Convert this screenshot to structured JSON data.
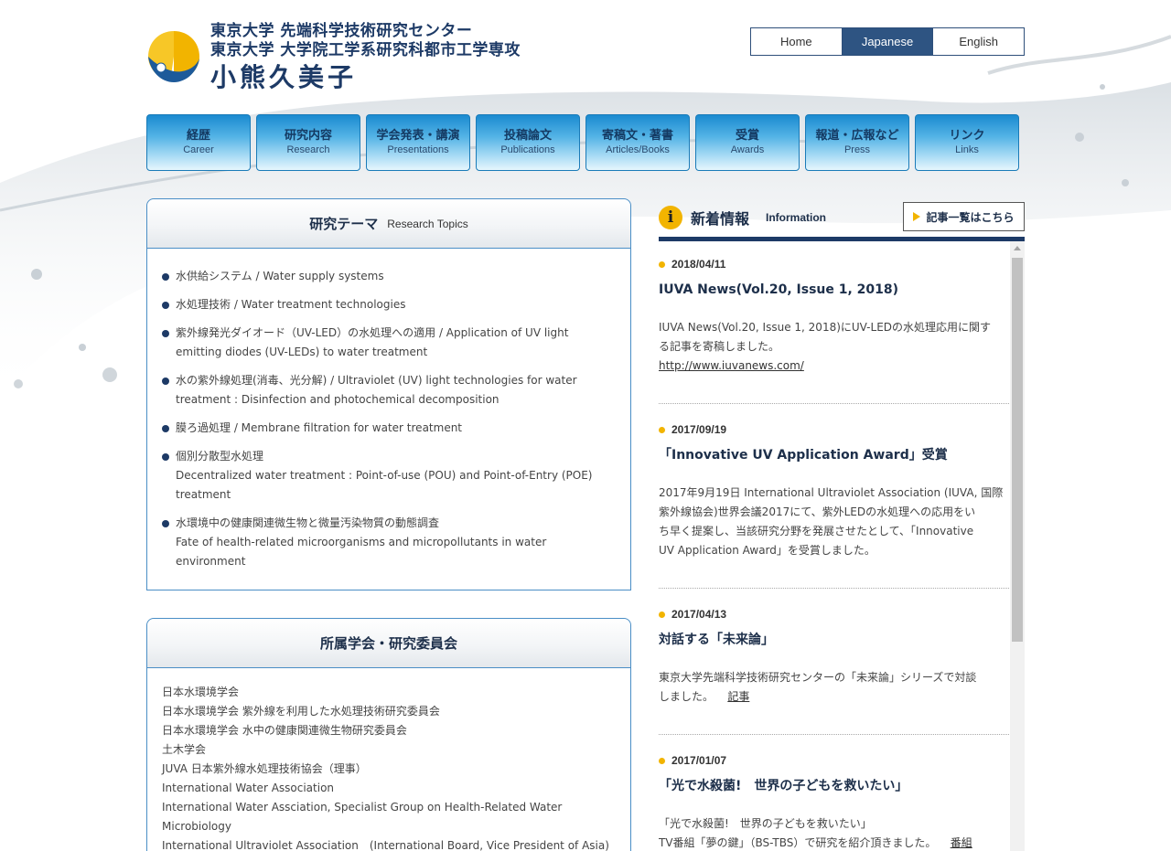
{
  "header": {
    "org_line1": "東京大学 先端科学技術研究センター",
    "org_line2": "東京大学 大学院工学系研究科都市工学専攻",
    "person_name": "小熊久美子"
  },
  "language_switch": {
    "items": [
      {
        "label": "Home",
        "active": false
      },
      {
        "label": "Japanese",
        "active": true
      },
      {
        "label": "English",
        "active": false
      }
    ]
  },
  "nav": {
    "items": [
      {
        "jp": "経歴",
        "en": "Career"
      },
      {
        "jp": "研究内容",
        "en": "Research"
      },
      {
        "jp": "学会発表・講演",
        "en": "Presentations"
      },
      {
        "jp": "投稿論文",
        "en": "Publications"
      },
      {
        "jp": "寄稿文・著書",
        "en": "Articles/Books"
      },
      {
        "jp": "受賞",
        "en": "Awards"
      },
      {
        "jp": "報道・広報など",
        "en": "Press"
      },
      {
        "jp": "リンク",
        "en": "Links"
      }
    ]
  },
  "research_topics": {
    "title_jp": "研究テーマ",
    "title_en": "Research Topics",
    "items": [
      {
        "lines": [
          "水供給システム / Water supply systems"
        ]
      },
      {
        "lines": [
          "水処理技術 / Water treatment technologies"
        ]
      },
      {
        "lines": [
          "紫外線発光ダイオード（UV-LED）の水処理への適用 / Application of UV light",
          "emitting diodes (UV-LEDs) to water treatment"
        ]
      },
      {
        "lines": [
          "水の紫外線処理(消毒、光分解) / Ultraviolet (UV) light technologies for water",
          "treatment : Disinfection and photochemical decomposition"
        ]
      },
      {
        "lines": [
          "膜ろ過処理 / Membrane filtration for water treatment"
        ]
      },
      {
        "lines": [
          "個別分散型水処理",
          "Decentralized water treatment : Point-of-use (POU) and Point-of-Entry (POE)",
          "treatment"
        ]
      },
      {
        "lines": [
          "水環境中の健康関連微生物と微量汚染物質の動態調査",
          "Fate of health-related microorganisms and micropollutants in water",
          "environment"
        ]
      }
    ]
  },
  "memberships": {
    "title": "所属学会・研究委員会",
    "items": [
      "日本水環境学会",
      "日本水環境学会 紫外線を利用した水処理技術研究委員会",
      "日本水環境学会 水中の健康関連微生物研究委員会",
      "土木学会",
      "JUVA 日本紫外線水処理技術協会（理事）",
      "International Water Association",
      "International Water Assciation, Specialist Group on Health-Related Water",
      "Microbiology",
      "International Ultraviolet Association　(International Board, Vice President of Asia)"
    ]
  },
  "news": {
    "title_jp": "新着情報",
    "title_en": "Information",
    "info_icon": "i",
    "all_link_label": "記事一覧はこちら",
    "items": [
      {
        "date": "2018/04/11",
        "headline": "IUVA News(Vol.20, Issue 1, 2018)",
        "body_lines": [
          "IUVA News(Vol.20, Issue 1, 2018)にUV-LEDの水処理応用に関す",
          "る記事を寄稿しました。"
        ],
        "link_text": "http://www.iuvanews.com/"
      },
      {
        "date": "2017/09/19",
        "headline": "「Innovative UV Application Award」受賞",
        "body_lines": [
          "2017年9月19日 International Ultraviolet Association (IUVA, 国際",
          "紫外線協会)世界会議2017にて、紫外LEDの水処理への応用をい",
          "ち早く提案し、当該研究分野を発展させたとして、「Innovative",
          "UV Application Award」を受賞しました。"
        ],
        "link_text": ""
      },
      {
        "date": "2017/04/13",
        "headline": "対話する「未来論」",
        "body_lines": [
          "東京大学先端科学技術研究センターの「未来論」シリーズで対談",
          "しました。"
        ],
        "link_text": "記事"
      },
      {
        "date": "2017/01/07",
        "headline": "「光で水殺菌!　世界の子どもを救いたい」",
        "body_lines": [
          "「光で水殺菌!　世界の子どもを救いたい」",
          "TV番組「夢の鍵」（BS-TBS）で研究を紹介頂きました。"
        ],
        "link_text": "番組"
      }
    ]
  },
  "colors": {
    "navy": "#1d3a66",
    "accent_yellow": "#f2b400",
    "nav_blue": "#1a8ad0",
    "active_lang": "#2e5482"
  }
}
